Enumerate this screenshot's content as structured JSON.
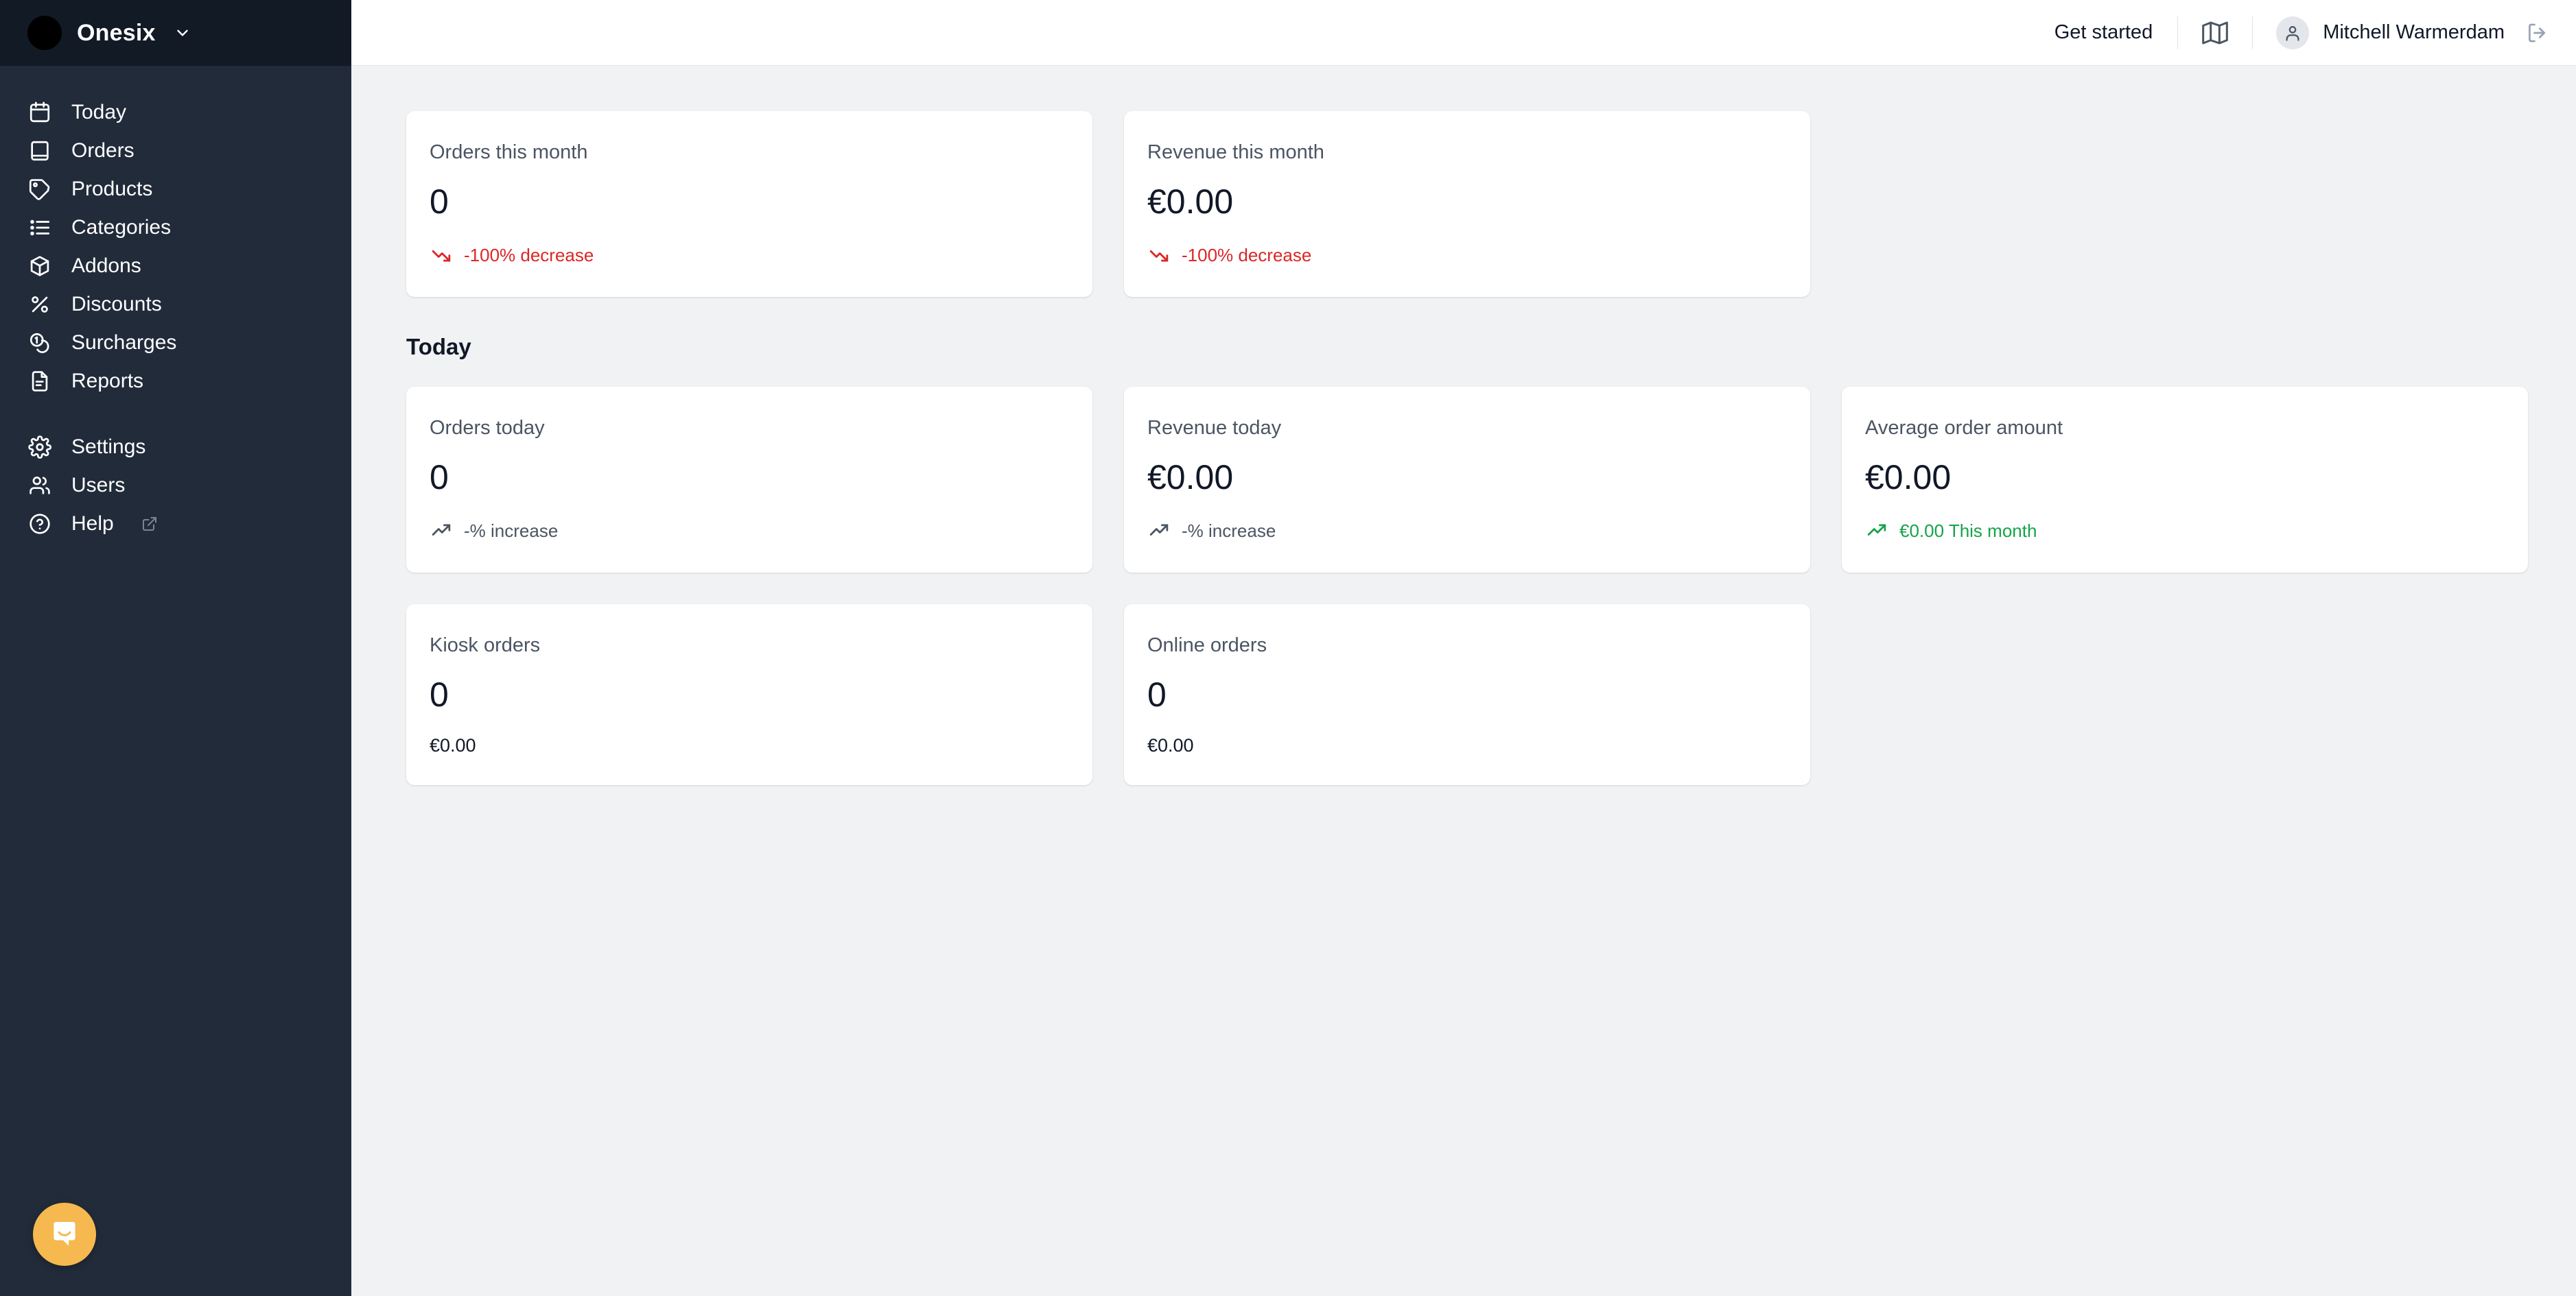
{
  "sidebar": {
    "brand": {
      "name": "Onesix",
      "avatar_icon": "brand-avatar",
      "chevron_icon": "chevron-down-icon"
    },
    "primary_items": [
      {
        "label": "Today",
        "icon": "calendar-icon"
      },
      {
        "label": "Orders",
        "icon": "book-icon"
      },
      {
        "label": "Products",
        "icon": "tag-icon"
      },
      {
        "label": "Categories",
        "icon": "list-icon"
      },
      {
        "label": "Addons",
        "icon": "box-icon"
      },
      {
        "label": "Discounts",
        "icon": "percent-icon"
      },
      {
        "label": "Surcharges",
        "icon": "coins-icon"
      },
      {
        "label": "Reports",
        "icon": "document-icon"
      }
    ],
    "secondary_items": [
      {
        "label": "Settings",
        "icon": "gear-icon",
        "external": false
      },
      {
        "label": "Users",
        "icon": "users-icon",
        "external": false
      },
      {
        "label": "Help",
        "icon": "question-circle-icon",
        "external": true
      }
    ],
    "chat_widget": {
      "icon": "chat-bubble-icon",
      "color": "#f5b94f"
    }
  },
  "topbar": {
    "get_started": "Get started",
    "map_icon": "map-icon",
    "avatar_icon": "user-icon",
    "user_name": "Mitchell Warmerdam",
    "logout_icon": "logout-icon"
  },
  "content": {
    "month_cards": [
      {
        "title": "Orders this month",
        "value": "0",
        "trend_icon": "trending-down-icon",
        "trend_text": "-100% decrease",
        "trend_tone": "negative"
      },
      {
        "title": "Revenue this month",
        "value": "€0.00",
        "trend_icon": "trending-down-icon",
        "trend_text": "-100% decrease",
        "trend_tone": "negative"
      }
    ],
    "today_heading": "Today",
    "today_cards": [
      {
        "title": "Orders today",
        "value": "0",
        "trend_icon": "trending-up-icon",
        "trend_text": "-% increase",
        "trend_tone": "neutral"
      },
      {
        "title": "Revenue today",
        "value": "€0.00",
        "trend_icon": "trending-up-icon",
        "trend_text": "-% increase",
        "trend_tone": "neutral"
      },
      {
        "title": "Average order amount",
        "value": "€0.00",
        "trend_icon": "trending-up-icon",
        "trend_text": "€0.00 This month",
        "trend_tone": "positive"
      }
    ],
    "channel_cards": [
      {
        "title": "Kiosk orders",
        "value": "0",
        "amount": "€0.00"
      },
      {
        "title": "Online orders",
        "value": "0",
        "amount": "€0.00"
      }
    ]
  },
  "colors": {
    "sidebar_bg": "#212b3a",
    "sidebar_brand_bg": "#121a26",
    "page_bg": "#f1f2f4",
    "card_bg": "#ffffff",
    "negative": "#dc2626",
    "positive": "#16a34a",
    "neutral_text": "#4b5563",
    "accent_chat": "#f5b94f"
  }
}
